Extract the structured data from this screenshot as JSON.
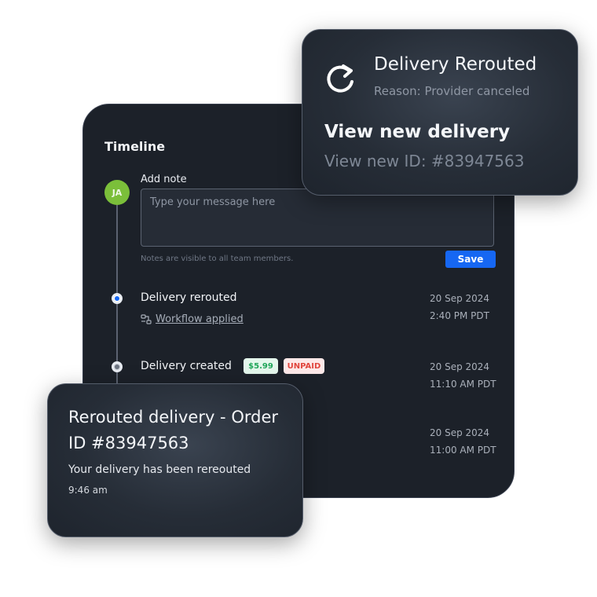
{
  "timeline": {
    "title": "Timeline",
    "note": {
      "avatar_initials": "JA",
      "label": "Add note",
      "placeholder": "Type your message here",
      "hint": "Notes are visible to all team members.",
      "save_label": "Save"
    },
    "events": [
      {
        "title": "Delivery rerouted",
        "link": "Workflow applied",
        "date": "20 Sep 2024",
        "time": "2:40 PM PDT"
      },
      {
        "title": "Delivery created",
        "price_badge": "$5.99",
        "status_badge": "UNPAID",
        "date": "20 Sep 2024",
        "time": "11:10 AM PDT"
      },
      {
        "date": "20 Sep 2024",
        "time": "11:00 AM PDT"
      }
    ]
  },
  "reroute_card": {
    "title": "Delivery Rerouted",
    "reason": "Reason: Provider canceled",
    "action": "View new delivery",
    "new_id": "View new ID: #83947563",
    "icon": "reroute-arrow-icon"
  },
  "notification_card": {
    "title": "Rerouted delivery - Order ID #83947563",
    "message": "Your delivery has been rereouted",
    "time": "9:46 am"
  },
  "colors": {
    "panel_bg": "#1c2129",
    "accent_blue": "#1667f3",
    "avatar_green": "#7bbf3a",
    "price_green": "#21a65a",
    "unpaid_red": "#e1463e"
  }
}
